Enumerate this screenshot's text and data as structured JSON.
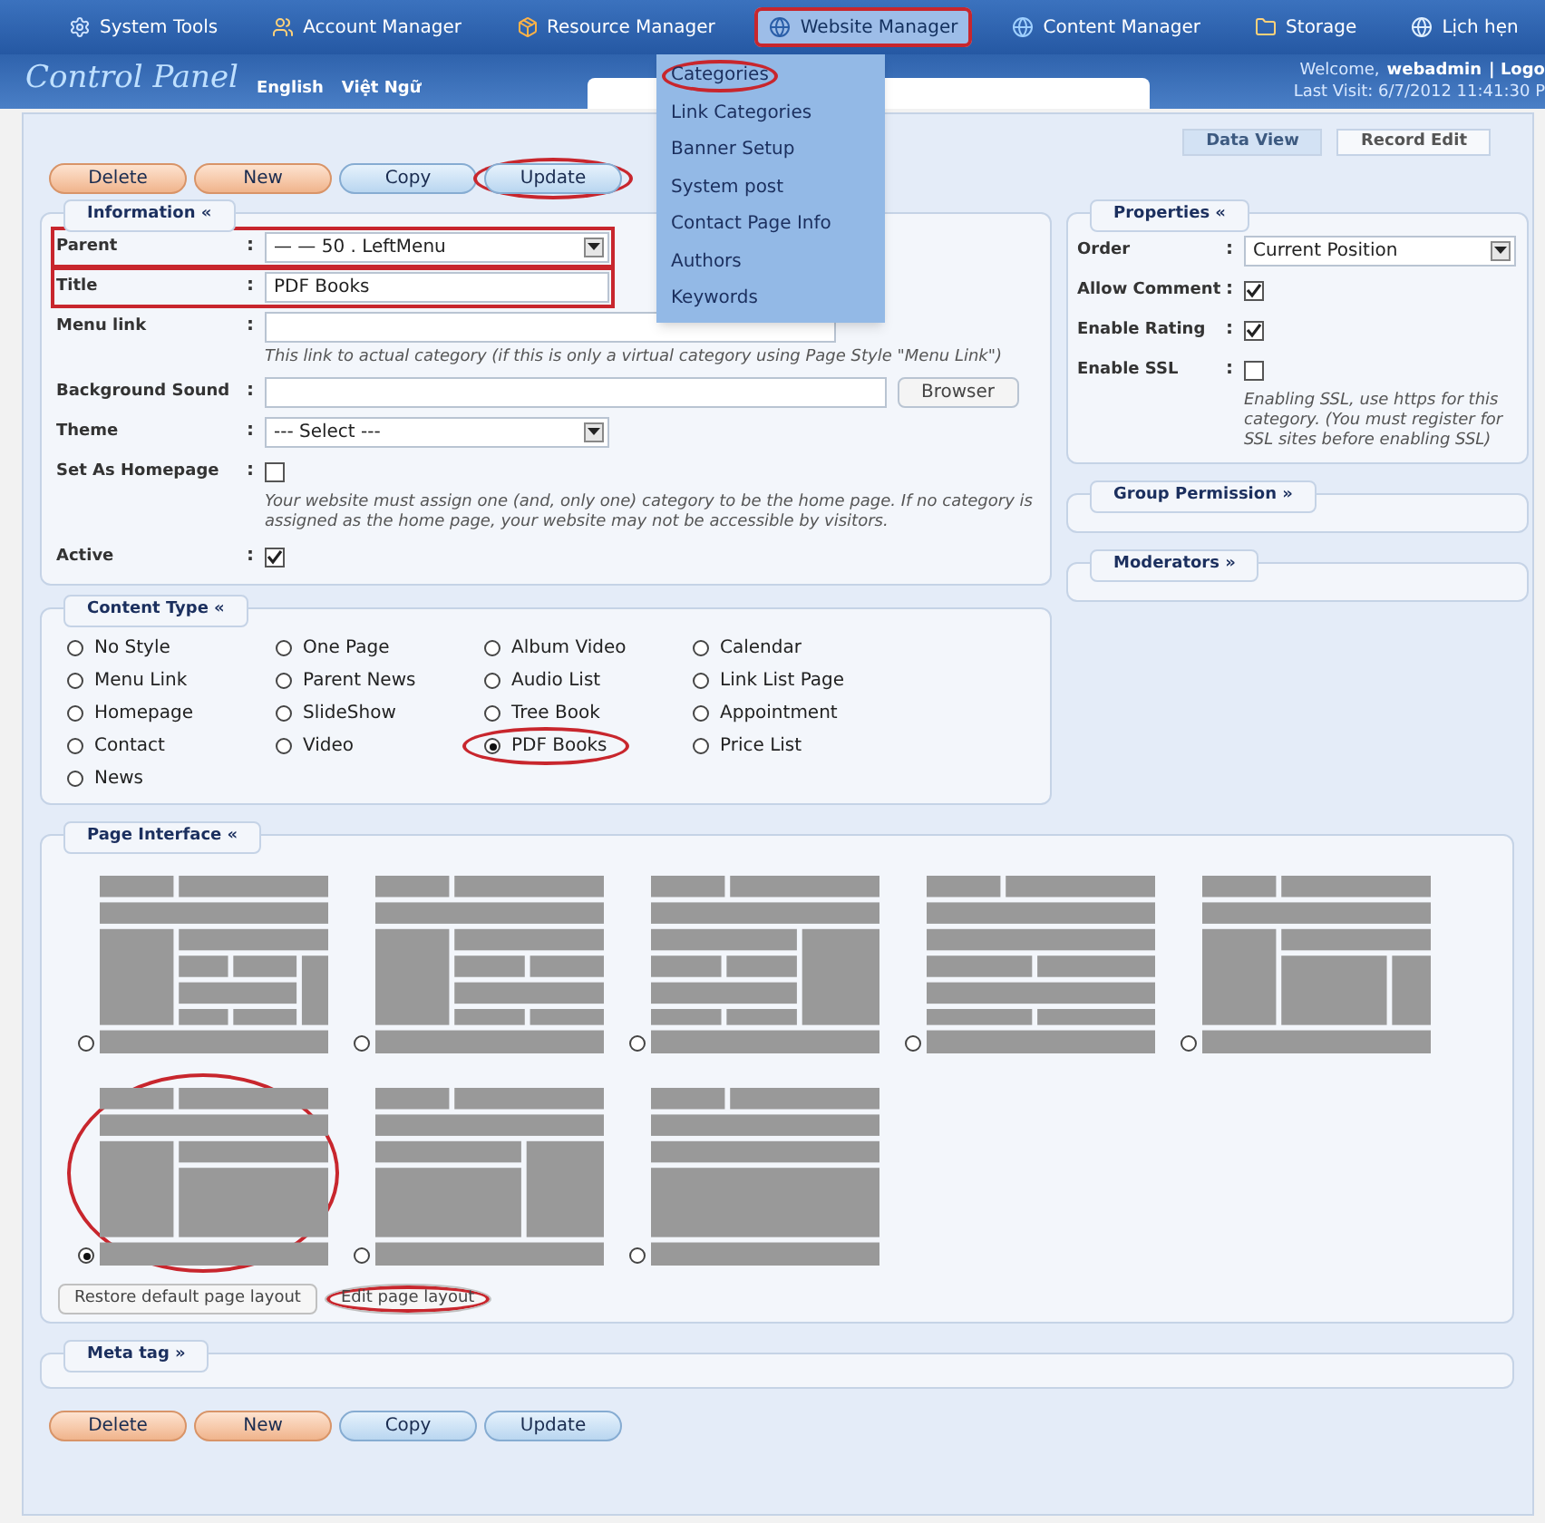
{
  "nav": {
    "items": [
      {
        "label": "System Tools",
        "selected": false,
        "annotated": false
      },
      {
        "label": "Account Manager",
        "selected": false,
        "annotated": false
      },
      {
        "label": "Resource Manager",
        "selected": false,
        "annotated": false
      },
      {
        "label": "Website Manager",
        "selected": true,
        "annotated": true
      },
      {
        "label": "Content Manager",
        "selected": false,
        "annotated": false
      },
      {
        "label": "Storage",
        "selected": false,
        "annotated": false
      },
      {
        "label": "Lịch hẹn",
        "selected": false,
        "annotated": false
      }
    ]
  },
  "header": {
    "logo": "Control Panel",
    "languages": [
      "English",
      "Việt Ngữ"
    ],
    "welcome": "Welcome,",
    "username": "webadmin",
    "logout": "| Logo",
    "last_visit": "Last Visit: 6/7/2012 11:41:30 P"
  },
  "dropdown": {
    "items": [
      {
        "label": "Categories",
        "annotated": true
      },
      {
        "label": "Link Categories",
        "annotated": false
      },
      {
        "label": "Banner Setup",
        "annotated": false
      },
      {
        "label": "System post",
        "annotated": false
      },
      {
        "label": "Contact Page Info",
        "annotated": false
      },
      {
        "label": "Authors",
        "annotated": false
      },
      {
        "label": "Keywords",
        "annotated": false
      }
    ]
  },
  "view_tabs": [
    {
      "label": "Data View",
      "selected": true
    },
    {
      "label": "Record Edit",
      "selected": false
    }
  ],
  "top_buttons": [
    {
      "label": "Delete",
      "kind": "warm",
      "annotated": false
    },
    {
      "label": "New",
      "kind": "warm",
      "annotated": false
    },
    {
      "label": "Copy",
      "kind": "cool",
      "annotated": false
    },
    {
      "label": "Update",
      "kind": "cool",
      "annotated": true
    }
  ],
  "information": {
    "title": "Information «",
    "fields": [
      {
        "label": "Parent",
        "separator": ":",
        "kind": "select",
        "value": "— — 50 . LeftMenu",
        "annotated": true
      },
      {
        "label": "Title",
        "separator": ":",
        "kind": "text",
        "value": "PDF Books",
        "annotated": true
      },
      {
        "label": "Menu link",
        "separator": ":",
        "kind": "text",
        "hint": "This link to actual category (if this is only a virtual category using Page Style \"Menu Link\")",
        "annotated": false
      },
      {
        "label": "Background Sound",
        "separator": ":",
        "kind": "file",
        "button": "Browser",
        "annotated": false
      },
      {
        "label": "Theme",
        "separator": ":",
        "kind": "select",
        "value": "--- Select ---",
        "annotated": false
      },
      {
        "label": "Set As Homepage",
        "separator": ":",
        "kind": "checkbox",
        "checked": false,
        "hint": "Your website must assign one (and, only one) category to be the home page. If no category is assigned as the home page, your website may not be accessible by visitors.",
        "annotated": false
      },
      {
        "label": "Active",
        "separator": ":",
        "kind": "checkbox",
        "checked": true,
        "annotated": false
      }
    ]
  },
  "properties": {
    "title": "Properties «",
    "fields": [
      {
        "label": "Order",
        "separator": ":",
        "kind": "select",
        "value": "Current Position"
      },
      {
        "label": "Allow Comment",
        "separator": ":",
        "kind": "checkbox",
        "checked": true
      },
      {
        "label": "Enable Rating",
        "separator": ":",
        "kind": "checkbox",
        "checked": true
      },
      {
        "label": "Enable SSL",
        "separator": ":",
        "kind": "checkbox",
        "checked": false,
        "hint": "Enabling SSL, use https for this category. (You must register for SSL sites before enabling SSL)"
      }
    ]
  },
  "group_permission": {
    "title": "Group Permission »"
  },
  "moderators": {
    "title": "Moderators »"
  },
  "content_type": {
    "title": "Content Type «",
    "options": [
      {
        "label": "No Style",
        "selected": false,
        "annotated": false
      },
      {
        "label": "One Page",
        "selected": false,
        "annotated": false
      },
      {
        "label": "Album Video",
        "selected": false,
        "annotated": false
      },
      {
        "label": "Calendar",
        "selected": false,
        "annotated": false
      },
      {
        "label": "Menu Link",
        "selected": false,
        "annotated": false
      },
      {
        "label": "Parent News",
        "selected": false,
        "annotated": false
      },
      {
        "label": "Audio List",
        "selected": false,
        "annotated": false
      },
      {
        "label": "Link List Page",
        "selected": false,
        "annotated": false
      },
      {
        "label": "Homepage",
        "selected": false,
        "annotated": false
      },
      {
        "label": "SlideShow",
        "selected": false,
        "annotated": false
      },
      {
        "label": "Tree Book",
        "selected": false,
        "annotated": false
      },
      {
        "label": "Appointment",
        "selected": false,
        "annotated": false
      },
      {
        "label": "Contact",
        "selected": false,
        "annotated": false
      },
      {
        "label": "Video",
        "selected": false,
        "annotated": false
      },
      {
        "label": "PDF Books",
        "selected": true,
        "annotated": true
      },
      {
        "label": "Price List",
        "selected": false,
        "annotated": false
      },
      {
        "label": "News",
        "selected": false,
        "annotated": false
      }
    ]
  },
  "page_interface": {
    "title": "Page Interface «",
    "layouts": [
      {
        "kind": "mixed",
        "selected": false,
        "annotated": false
      },
      {
        "kind": "leftgrid",
        "selected": false,
        "annotated": false
      },
      {
        "kind": "rightcol",
        "selected": false,
        "annotated": false
      },
      {
        "kind": "rows",
        "selected": false,
        "annotated": false
      },
      {
        "kind": "threecol",
        "selected": false,
        "annotated": false
      },
      {
        "kind": "leftwide",
        "selected": true,
        "annotated": true
      },
      {
        "kind": "rightwide",
        "selected": false,
        "annotated": false
      },
      {
        "kind": "full",
        "selected": false,
        "annotated": false
      }
    ],
    "buttons": [
      {
        "label": "Restore default page layout",
        "annotated": false
      },
      {
        "label": "Edit page layout",
        "annotated": true
      }
    ]
  },
  "meta_tag": {
    "title": "Meta tag »"
  },
  "bottom_buttons": [
    {
      "label": "Delete",
      "kind": "warm",
      "annotated": false
    },
    {
      "label": "New",
      "kind": "warm",
      "annotated": false
    },
    {
      "label": "Copy",
      "kind": "cool",
      "annotated": false
    },
    {
      "label": "Update",
      "kind": "cool",
      "annotated": false
    }
  ]
}
